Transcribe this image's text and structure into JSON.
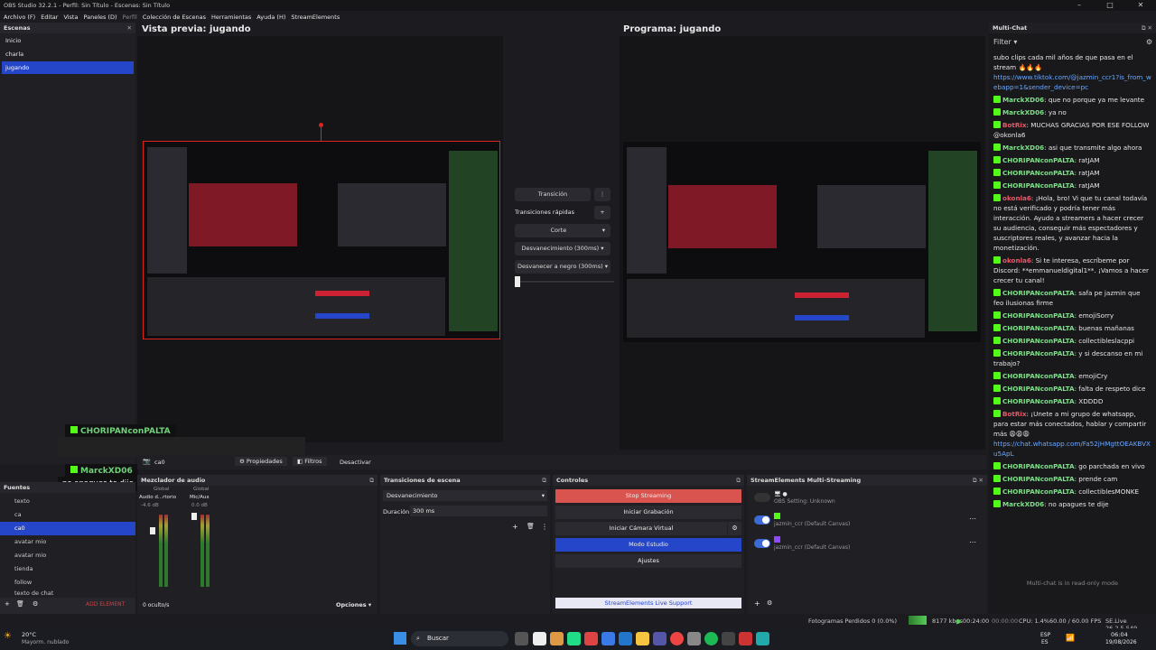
{
  "window": {
    "title": "OBS Studio 32.2.1 - Perfil: Sin Título - Escenas: Sin Título",
    "min": "–",
    "max": "□",
    "close": "✕"
  },
  "menu": [
    "Archivo (F)",
    "Editar",
    "Vista",
    "Paneles (D)",
    "Perfil",
    "Colección de Escenas",
    "Herramientas",
    "Ayuda (H)",
    "StreamElements"
  ],
  "scenes": {
    "title": "Escenas",
    "items": [
      "Inicio",
      "charla",
      "jugando"
    ]
  },
  "preview": {
    "label": "Vista previa: jugando"
  },
  "program": {
    "label": "Programa: jugando"
  },
  "transitions_center": {
    "transition": "Transición",
    "quick": "Transiciones rápidas",
    "cut": "Corte",
    "fade": "Desvanecimiento (300ms)",
    "fade_black": "Desvanecer a negro (300ms)"
  },
  "source_bar": {
    "source": "ca0",
    "props": "Propiedades",
    "filters": "Filtros",
    "deactivate": "Desactivar"
  },
  "sources": {
    "title": "Fuentes",
    "items": [
      "texto",
      "ca",
      "ca0",
      "avatar mio",
      "avatar mio",
      "tienda",
      "follow",
      "texto de chat"
    ],
    "add": "ADD ELEMENT"
  },
  "mixer": {
    "title": "Mezclador de audio",
    "global1": "Global",
    "global2": "Global",
    "ch1": "Audio d...rtorio",
    "ch2": "Mic/Aux",
    "db1": "-4.6 dB",
    "db2": "0.0 dB",
    "hidden": "0 oculto/s",
    "options": "Opciones"
  },
  "scene_trans": {
    "title": "Transiciones de escena",
    "type": "Desvanecimiento",
    "duration_label": "Duración",
    "duration": "300 ms"
  },
  "controls": {
    "title": "Controles",
    "stop": "Stop Streaming",
    "record": "Iniciar Grabación",
    "vcam": "Iniciar Cámara Virtual",
    "studio": "Modo Estudio",
    "settings": "Ajustes",
    "support": "StreamElements Live Support"
  },
  "se_multi": {
    "title": "StreamElements Multi-Streaming",
    "obs": "OBS Setting: Unknown",
    "acc1": "jazmin_ccr (Default Canvas)",
    "acc2": "jazmin_ccr (Default Canvas)"
  },
  "overlay": {
    "name1": "CHORIPANconPALTA",
    "name2": "MarckXD06",
    "msg2": "no apagues te dije"
  },
  "chat": {
    "title": "Multi-Chat",
    "filter": "Filter",
    "footer": "Multi-chat is in read-only mode",
    "top": "subo clips cada mil años de que pasa en el stream 🔥🔥🔥",
    "top_link": "https://www.tiktok.com/@jazmin_ccr1?is_from_webapp=1&sender_device=pc",
    "messages": [
      {
        "n": "MarckXD06",
        "t": "que no porque ya me levante"
      },
      {
        "n": "MarckXD06",
        "t": "ya no"
      },
      {
        "n": "BotRix",
        "t": "MUCHAS GRACIAS POR ESE FOLLOW @okonla6",
        "red": true
      },
      {
        "n": "MarckXD06",
        "t": "asi que transmite algo ahora"
      },
      {
        "n": "CHORIPANconPALTA",
        "t": "ratJAM"
      },
      {
        "n": "CHORIPANconPALTA",
        "t": "ratJAM"
      },
      {
        "n": "CHORIPANconPALTA",
        "t": "ratJAM"
      },
      {
        "n": "okonla6",
        "t": "¡Hola, bro! Vi que tu canal todavía no está verificado y podría tener más interacción. Ayudo a streamers a hacer crecer su audiencia, conseguir más espectadores y suscriptores reales, y avanzar hacia la monetización.",
        "red": true
      },
      {
        "n": "okonla6",
        "t": "Si te interesa, escríbeme por Discord: **emmanueldigital1**. ¡Vamos a hacer crecer tu canal!",
        "red": true
      },
      {
        "n": "CHORIPANconPALTA",
        "t": "safa pe jazmin que feo ilusionas firme"
      },
      {
        "n": "CHORIPANconPALTA",
        "t": "emojiSorry"
      },
      {
        "n": "CHORIPANconPALTA",
        "t": "buenas mañanas"
      },
      {
        "n": "CHORIPANconPALTA",
        "t": "collectibleslacppi"
      },
      {
        "n": "CHORIPANconPALTA",
        "t": "y si descanso en mi trabajo?"
      },
      {
        "n": "CHORIPANconPALTA",
        "t": "emojiCry"
      },
      {
        "n": "CHORIPANconPALTA",
        "t": "falta de respeto dice"
      },
      {
        "n": "CHORIPANconPALTA",
        "t": "XDDDD"
      },
      {
        "n": "BotRix",
        "t": "¡Unete a mi grupo de whatsapp, para estar más conectados, hablar y compartir más 😩😩😩",
        "red": true,
        "link": "https://chat.whatsapp.com/Fa52jHMgttOEAKBVXu5ApL"
      },
      {
        "n": "CHORIPANconPALTA",
        "t": "go parchada en vivo"
      },
      {
        "n": "CHORIPANconPALTA",
        "t": "prende cam"
      },
      {
        "n": "CHORIPANconPALTA",
        "t": "collectiblesMONKE"
      },
      {
        "n": "MarckXD06",
        "t": "no apagues te dije"
      }
    ]
  },
  "status": {
    "frames": "Fotogramas Perdidos 0 (0.0%)",
    "kbps": "8177 kbps",
    "live_time": "00:24:00",
    "rec_time": "00:00:00",
    "cpu": "CPU: 1.4%",
    "fps": "60.00 / 60.00 FPS",
    "version": "SE.Live 26.2.5.549"
  },
  "taskbar": {
    "temp": "20°C",
    "weather": "Mayorm. nublado",
    "search": "Buscar",
    "lang": "ESP",
    "lang2": "ES",
    "time": "06:04",
    "date": "19/08/2026"
  },
  "colors": {
    "accent": "#2546c8",
    "stop": "#d9534f",
    "kick": "#53fc18"
  }
}
